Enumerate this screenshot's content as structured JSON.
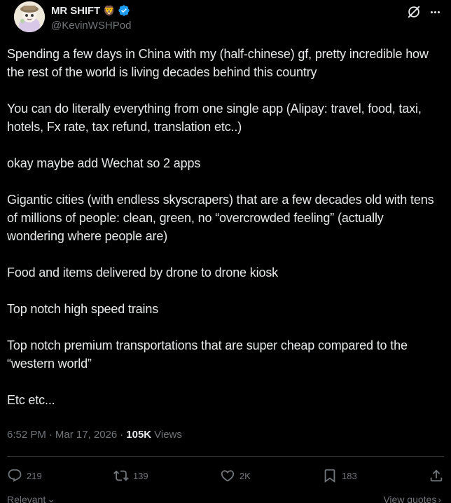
{
  "author": {
    "display_name": "MR SHIFT",
    "name_emoji": "🦁",
    "handle": "@KevinWSHPod",
    "verified_color": "#1d9bf0"
  },
  "tweet": {
    "paragraphs": [
      "Spending a few days in China with my (half-chinese) gf, pretty incredible how the rest of the world is living decades behind this country",
      "You can do literally everything from one single app (Alipay: travel, food, taxi, hotels, Fx rate, tax refund, translation etc..)",
      "okay maybe add Wechat so 2 apps",
      "Gigantic cities (with endless skyscrapers) that are a few decades old with tens of millions of people: clean, green, no “overcrowded feeling” (actually wondering where people are)",
      "Food and items delivered by drone to drone kiosk",
      "Top notch high speed trains",
      "Top notch premium transportations that are super cheap compared to the “western world”",
      "Etc etc..."
    ]
  },
  "meta": {
    "time": "6:52 PM",
    "separator": "·",
    "date": "Mar 17, 2026",
    "views_count": "105K",
    "views_label": "Views"
  },
  "actions": {
    "replies": "219",
    "reposts": "139",
    "likes": "2K",
    "bookmarks": "183"
  },
  "footer": {
    "sort_label": "Relevant",
    "sort_chevron": "⌄",
    "quotes_label": "View quotes",
    "quotes_chevron": "›"
  },
  "colors": {
    "background": "#000000",
    "text": "#e7e9ea",
    "muted": "#71767b",
    "divider": "#2f3336"
  },
  "icons": {
    "verified": "verified-badge-icon",
    "grok": "grok-icon",
    "more": "more-dots-icon",
    "reply": "reply-icon",
    "repost": "repost-icon",
    "like": "heart-icon",
    "bookmark": "bookmark-icon",
    "share": "share-icon"
  }
}
